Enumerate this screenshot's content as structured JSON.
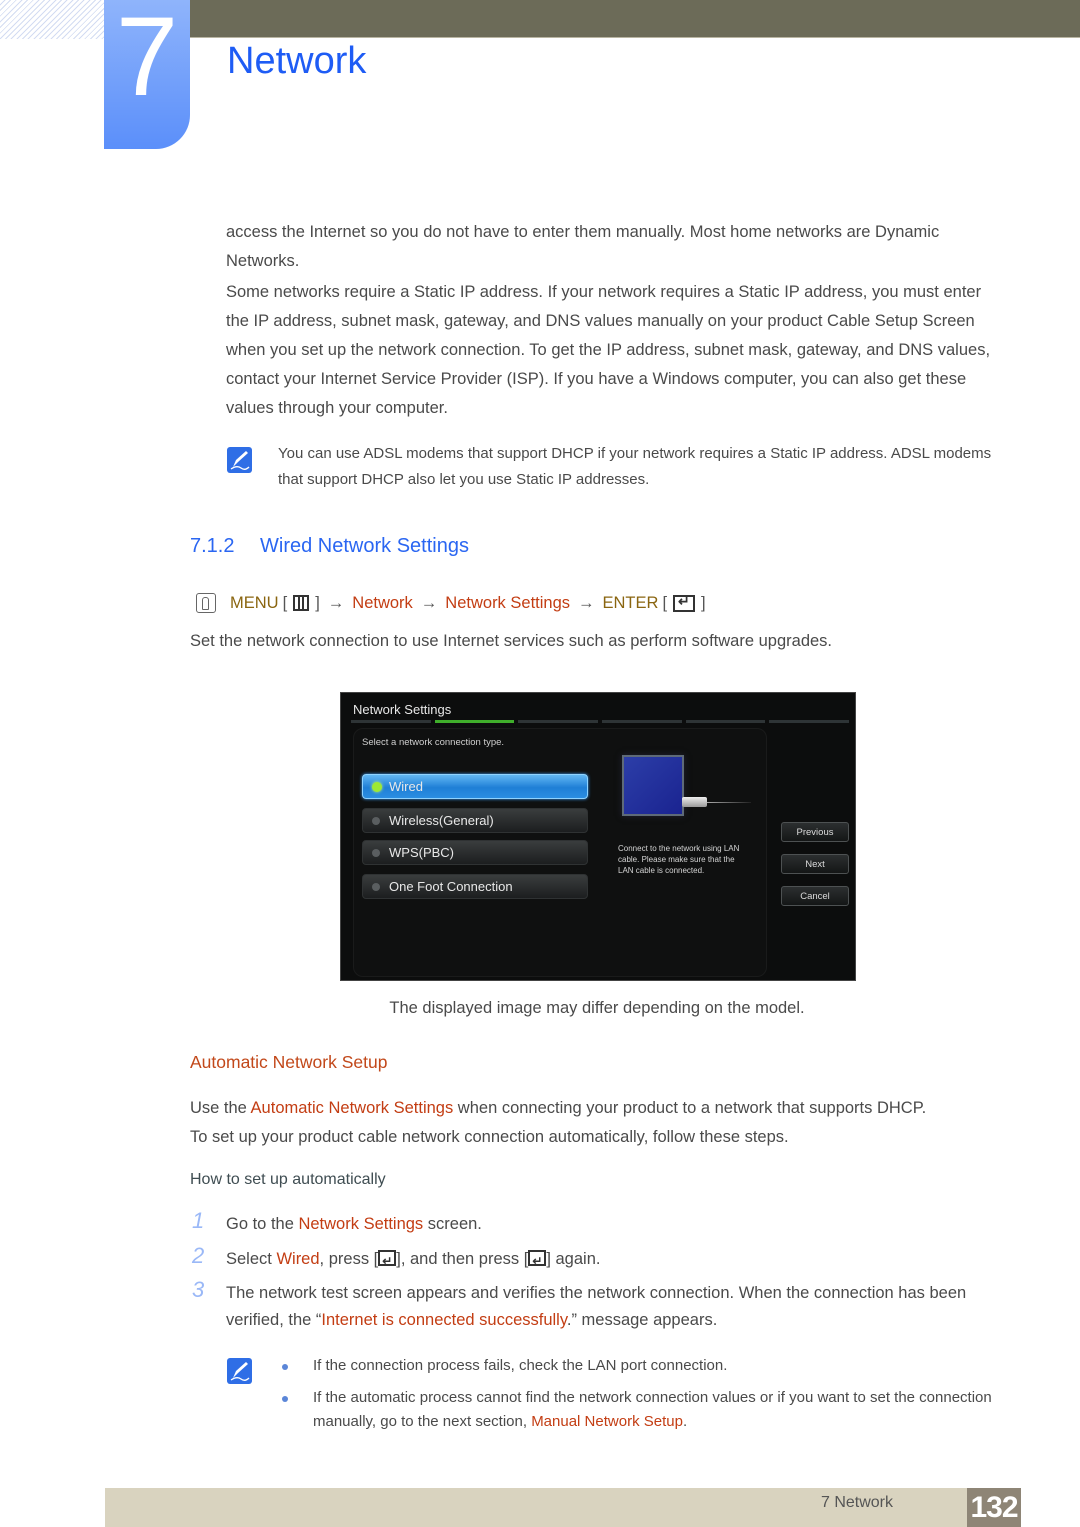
{
  "chapter": {
    "number": "7",
    "title": "Network"
  },
  "intro_paragraphs": [
    "access the Internet so you do not have to enter them manually. Most home networks are Dynamic Networks.",
    "Some networks require a Static IP address. If your network requires a Static IP address, you must enter the IP address, subnet mask, gateway, and DNS values manually on your product Cable Setup Screen when you set up the network connection. To get the IP address, subnet mask, gateway, and DNS values, contact your Internet Service Provider (ISP). If you have a Windows computer, you can also get these values through your computer."
  ],
  "note1": "You can use ADSL modems that support DHCP if your network requires a Static IP address. ADSL modems that support DHCP also let you use Static IP addresses.",
  "section": {
    "number": "7.1.2",
    "title": "Wired Network Settings"
  },
  "menu_path": {
    "menu": "MENU",
    "step1": "Network",
    "step2": "Network Settings",
    "enter": "ENTER",
    "arrow": "→",
    "open_bracket": "[",
    "close_bracket": "]"
  },
  "section_intro": "Set the network connection to use Internet services such as perform software upgrades.",
  "tv_screen": {
    "title": "Network Settings",
    "prompt": "Select a network connection type.",
    "options": [
      {
        "label": "Wired",
        "selected": true
      },
      {
        "label": "Wireless(General)",
        "selected": false
      },
      {
        "label": "WPS(PBC)",
        "selected": false
      },
      {
        "label": "One Foot Connection",
        "selected": false
      }
    ],
    "description": "Connect to the network using LAN cable. Please make sure that the LAN cable is connected.",
    "buttons": {
      "previous": "Previous",
      "next": "Next",
      "cancel": "Cancel"
    },
    "progress_step": 2,
    "progress_total": 6
  },
  "caption": "The displayed image may differ depending on the model.",
  "auto_setup": {
    "heading": "Automatic Network Setup",
    "p1_pre": "Use the ",
    "p1_em": "Automatic Network Settings",
    "p1_post": " when connecting your product to a network that supports DHCP.",
    "p2": "To set up your product cable network connection automatically, follow these steps.",
    "howto": "How to set up automatically"
  },
  "steps": [
    {
      "num": "1",
      "pre": "Go to the ",
      "em": "Network Settings",
      "post": " screen."
    },
    {
      "num": "2",
      "pre": "Select ",
      "em": "Wired",
      "mid": ", press [",
      "mid2": "], and then press [",
      "post": "] again."
    },
    {
      "num": "3",
      "pre": "The network test screen appears and verifies the network connection. When the connection has been verified, the “",
      "em": "Internet is connected successfully",
      "post": ".” message appears."
    }
  ],
  "notes2": [
    {
      "text": "If the connection process fails, check the LAN port connection."
    },
    {
      "pre": "If the automatic process cannot find the network connection values or if you want to set the connection manually, go to the next section, ",
      "em": "Manual Network Setup",
      "post": "."
    }
  ],
  "footer": {
    "label": "7 Network",
    "page": "132"
  },
  "colors": {
    "chapter_blue": "#1e5cf5",
    "heading_blue": "#2a66f2",
    "emphasis_red": "#c33d13",
    "menu_gold": "#8a6510",
    "top_bar": "#6c6b58",
    "footer_bg": "#d9d3bf",
    "page_badge": "#8e8576"
  }
}
